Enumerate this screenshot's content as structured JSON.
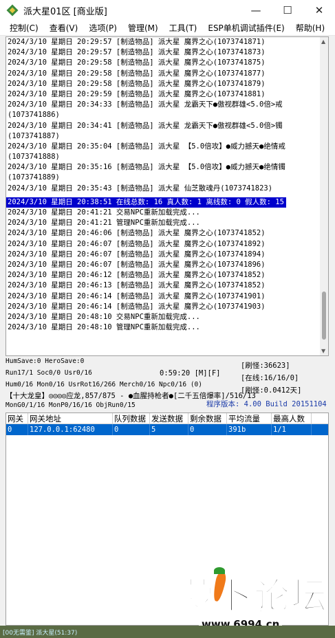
{
  "window": {
    "title": "派大星01区 [商业版]",
    "minimize_glyph": "—",
    "maximize_glyph": "☐",
    "close_glyph": "✕"
  },
  "menu": [
    "控制(C)",
    "查看(V)",
    "选项(P)",
    "管理(M)",
    "工具(T)",
    "ESP单机调试插件(E)",
    "帮助(H)"
  ],
  "log": {
    "lines": [
      "2024/3/10 星期日 20:29:57 [制造物品] 派大星 魔界之心(1073741871)",
      "2024/3/10 星期日 20:29:57 [制造物品] 派大星 魔界之心(1073741873)",
      "2024/3/10 星期日 20:29:58 [制造物品] 派大星 魔界之心(1073741875)",
      "2024/3/10 星期日 20:29:58 [制造物品] 派大星 魔界之心(1073741877)",
      "2024/3/10 星期日 20:29:58 [制造物品] 派大星 魔界之心(1073741879)",
      "2024/3/10 星期日 20:29:59 [制造物品] 派大星 魔界之心(1073741881)",
      "2024/3/10 星期日 20:34:33 [制造物品] 派大星 龙霸天下●傲视群雄<5.0倍>戒",
      "(1073741886)",
      "2024/3/10 星期日 20:34:41 [制造物品] 派大星 龙霸天下●傲视群雄<5.0倍>镯",
      "(1073741887)",
      "2024/3/10 星期日 20:35:04 [制造物品] 派大星 【5.0倍攻】●威力撼天●绝情戒",
      "(1073741888)",
      "2024/3/10 星期日 20:35:16 [制造物品] 派大星 【5.0倍攻】●威力撼天●绝情镯",
      "(1073741889)",
      "2024/3/10 星期日 20:35:43 [制造物品] 派大星 仙芝散魂丹(1073741823)",
      "2024/3/10 星期日 20:38:51 在线总数: 16 真人数: 1 离线数: 0 假人数: 15",
      "2024/3/10 星期日 20:41:21 交易NPC重新加载完成...",
      "2024/3/10 星期日 20:41:21 管理NPC重新加载完成...",
      "2024/3/10 星期日 20:46:06 [制造物品] 派大星 魔界之心(1073741852)",
      "2024/3/10 星期日 20:46:07 [制造物品] 派大星 魔界之心(1073741892)",
      "2024/3/10 星期日 20:46:07 [制造物品] 派大星 魔界之心(1073741894)",
      "2024/3/10 星期日 20:46:07 [制造物品] 派大星 魔界之心(1073741896)",
      "2024/3/10 星期日 20:46:12 [制造物品] 派大星 魔界之心(1073741852)",
      "2024/3/10 星期日 20:46:13 [制造物品] 派大星 魔界之心(1073741852)",
      "2024/3/10 星期日 20:46:14 [制造物品] 派大星 魔界之心(1073741901)",
      "2024/3/10 星期日 20:46:14 [制造物品] 派大星 魔界之心(1073741903)",
      "2024/3/10 星期日 20:48:10 交易NPC重新加载完成...",
      "2024/3/10 星期日 20:48:10 管理NPC重新加载完成..."
    ],
    "selected_line": 15
  },
  "status": {
    "line1": "HumSave:0 HeroSave:0",
    "line2": "Run17/1 Soc0/0 Usr0/16",
    "clock": "0:59:20 [M][F]",
    "line3": "Hum0/16 Mon0/16 UsrRot16/266 Merch0/16 Npc0/16 (0)",
    "line4": "【十大龙皇】◎◎◎◎应龙,857/875 - ●血腥持枪者●[二千五倍爆率]/516/13",
    "line5": "MonG0/1/16 MonP0/16/16 ObjRun0/15",
    "refresh": "[刷怪:36623]",
    "online": "[在线:16/16/0]",
    "overlap": "[刷怪:0.0412天]",
    "version": "程序版本: 4.00 Build 20151104"
  },
  "table": {
    "headers": [
      "网关",
      "网关地址",
      "队列数据",
      "发送数据",
      "剩余数据",
      "平均流量",
      "最高人数"
    ],
    "rows": [
      [
        "0",
        "127.0.0.1:62480",
        "0",
        "5",
        "0",
        "391b",
        "1/1"
      ]
    ]
  },
  "watermark": {
    "brand": "萝卜论坛",
    "url": "www.6994.cn"
  },
  "background_text": "[00无需鉴] 派大星(51:37)"
}
